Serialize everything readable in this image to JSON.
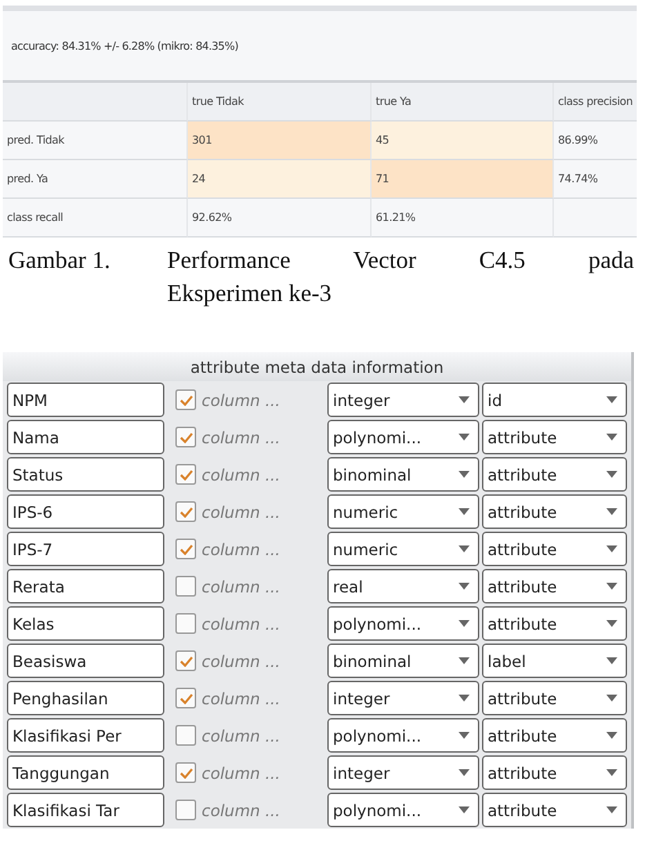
{
  "performance": {
    "accuracy": "accuracy: 84.31% +/- 6.28% (mikro: 84.35%)",
    "columns": [
      "true Tidak",
      "true Ya",
      "class precision"
    ],
    "rows": [
      {
        "label": "pred. Tidak",
        "cells": [
          {
            "text": "301",
            "color": "#fde3c6"
          },
          {
            "text": "45",
            "color": "#fdf1de"
          },
          {
            "text": "86.99%"
          }
        ]
      },
      {
        "label": "pred. Ya",
        "cells": [
          {
            "text": "24",
            "color": "#fdf1de"
          },
          {
            "text": "71",
            "color": "#fde3c6"
          },
          {
            "text": "74.74%"
          }
        ]
      },
      {
        "label": "class recall",
        "cells": [
          {
            "text": "92.62%"
          },
          {
            "text": "61.21%"
          },
          {
            "text": ""
          }
        ]
      }
    ]
  },
  "caption": {
    "label": "Gambar 1.",
    "lines": [
      "Performance Vector C4.5 pada",
      "Eksperimen ke-3"
    ]
  },
  "meta": {
    "title": "attribute meta data information",
    "rows": [
      {
        "name": "NPM",
        "checked": true,
        "column": "column ...",
        "type": "integer",
        "role": "id"
      },
      {
        "name": "Nama",
        "checked": true,
        "column": "column ...",
        "type": "polynomi...",
        "role": "attribute"
      },
      {
        "name": "Status",
        "checked": true,
        "column": "column ...",
        "type": "binominal",
        "role": "attribute"
      },
      {
        "name": "IPS-6",
        "checked": true,
        "column": "column ...",
        "type": "numeric",
        "role": "attribute"
      },
      {
        "name": "IPS-7",
        "checked": true,
        "column": "column ...",
        "type": "numeric",
        "role": "attribute"
      },
      {
        "name": "Rerata",
        "checked": false,
        "column": "column ...",
        "type": "real",
        "role": "attribute"
      },
      {
        "name": "Kelas",
        "checked": false,
        "column": "column ...",
        "type": "polynomi...",
        "role": "attribute"
      },
      {
        "name": "Beasiswa",
        "checked": true,
        "column": "column ...",
        "type": "binominal",
        "role": "label"
      },
      {
        "name": "Penghasilan",
        "checked": true,
        "column": "column ...",
        "type": "integer",
        "role": "attribute"
      },
      {
        "name": "Klasifikasi Per",
        "checked": false,
        "column": "column ...",
        "type": "polynomi...",
        "role": "attribute"
      },
      {
        "name": "Tanggungan",
        "checked": true,
        "column": "column ...",
        "type": "integer",
        "role": "attribute"
      },
      {
        "name": "Klasifikasi Tar",
        "checked": false,
        "column": "column ...",
        "type": "polynomi...",
        "role": "attribute"
      }
    ]
  }
}
